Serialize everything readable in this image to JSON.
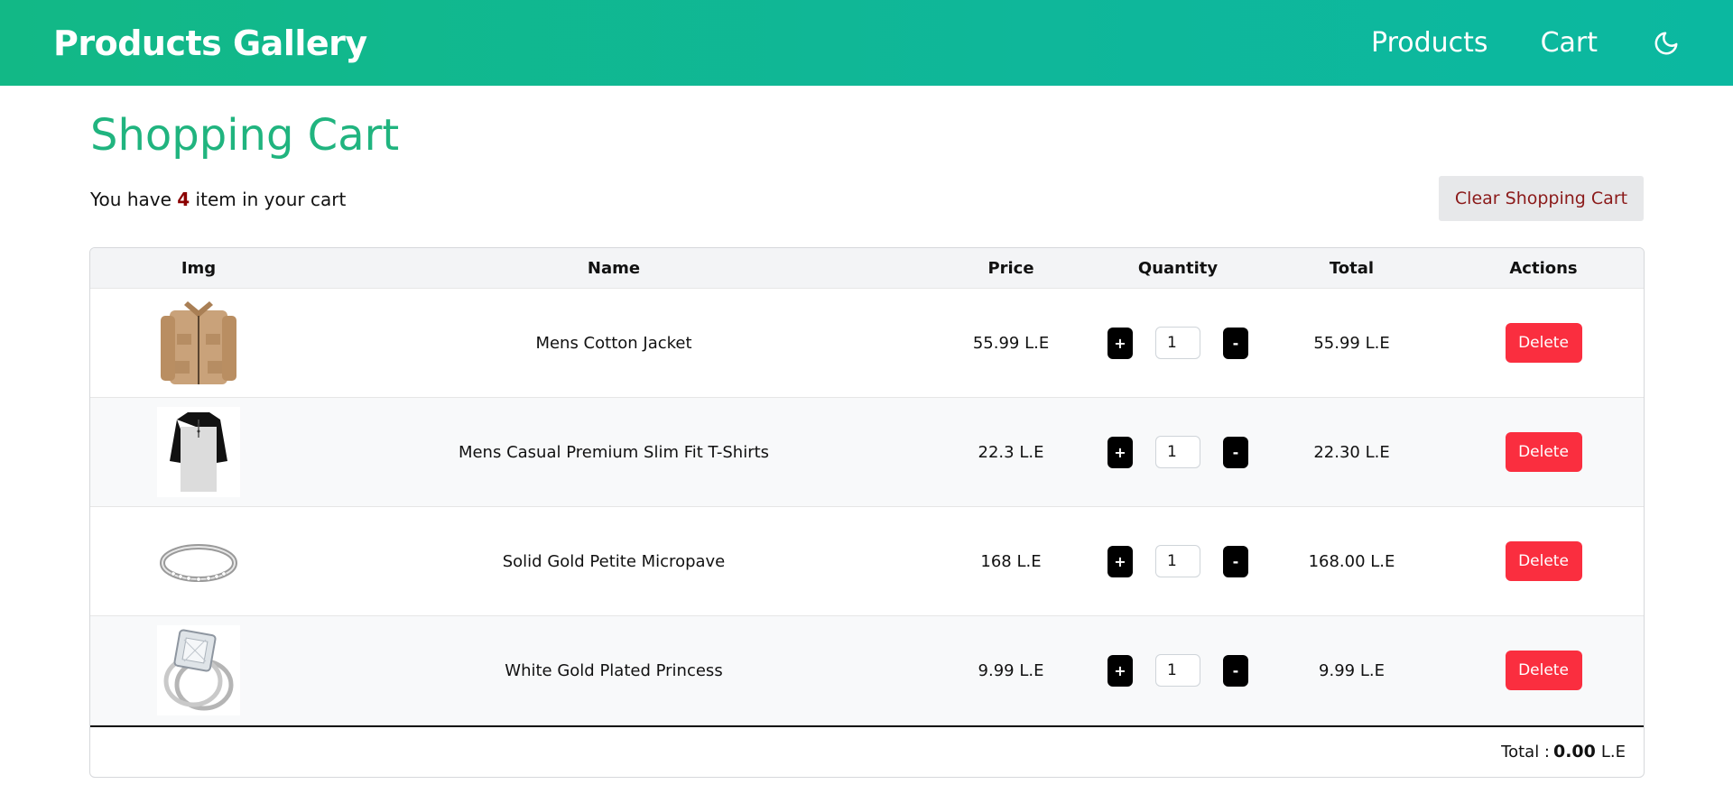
{
  "navbar": {
    "brand": "Products Gallery",
    "links": [
      "Products",
      "Cart"
    ],
    "theme_icon": "moon-icon"
  },
  "cart": {
    "title": "Shopping Cart",
    "summary_prefix": "You have",
    "item_count": "4",
    "summary_suffix": "item in your cart",
    "clear_label": "Clear Shopping Cart",
    "headers": [
      "Img",
      "Name",
      "Price",
      "Quantity",
      "Total",
      "Actions"
    ],
    "items": [
      {
        "image": "jacket",
        "name": "Mens Cotton Jacket",
        "price": "55.99 L.E",
        "qty": "1",
        "total": "55.99 L.E"
      },
      {
        "image": "tshirt",
        "name": "Mens Casual Premium Slim Fit T-Shirts",
        "price": "22.3 L.E",
        "qty": "1",
        "total": "22.30 L.E"
      },
      {
        "image": "ring",
        "name": "Solid Gold Petite Micropave",
        "price": "168 L.E",
        "qty": "1",
        "total": "168.00 L.E"
      },
      {
        "image": "princess-ring",
        "name": "White Gold Plated Princess",
        "price": "9.99 L.E",
        "qty": "1",
        "total": "9.99 L.E"
      }
    ],
    "plus_label": "+",
    "minus_label": "-",
    "delete_label": "Delete",
    "footer_label": "Total :",
    "footer_amount": "0.00",
    "footer_currency": "L.E"
  },
  "colors": {
    "navbar": "#12b886",
    "title": "#20b47f",
    "delete": "#fa2e3f",
    "count": "#8b0000"
  }
}
